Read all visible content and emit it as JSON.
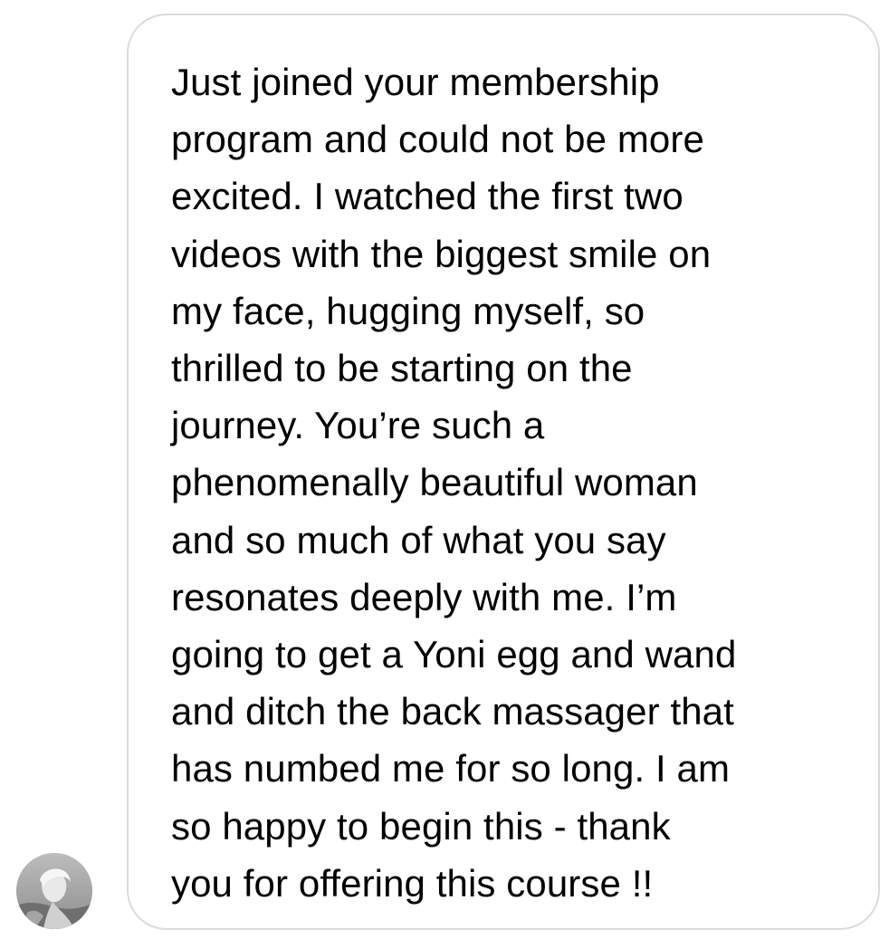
{
  "chat": {
    "sender": {
      "avatar_icon": "profile-photo-avatar"
    },
    "message": {
      "text": "Just joined your membership\nprogram and could not be more\nexcited. I watched the first two\nvideos with the biggest smile on\nmy face, hugging myself, so\nthrilled to be starting on the\njourney. You’re such a\nphenomenally beautiful woman\nand so much of what you say\nresonates deeply with me. I’m\ngoing to get a Yoni egg and wand\nand ditch the back massager that\nhas numbed me for so long. I am\nso happy to begin this - thank\nyou for offering this course !!"
    }
  },
  "colors": {
    "background": "#ffffff",
    "bubble_border": "#dbdbdb",
    "text": "#000000"
  }
}
